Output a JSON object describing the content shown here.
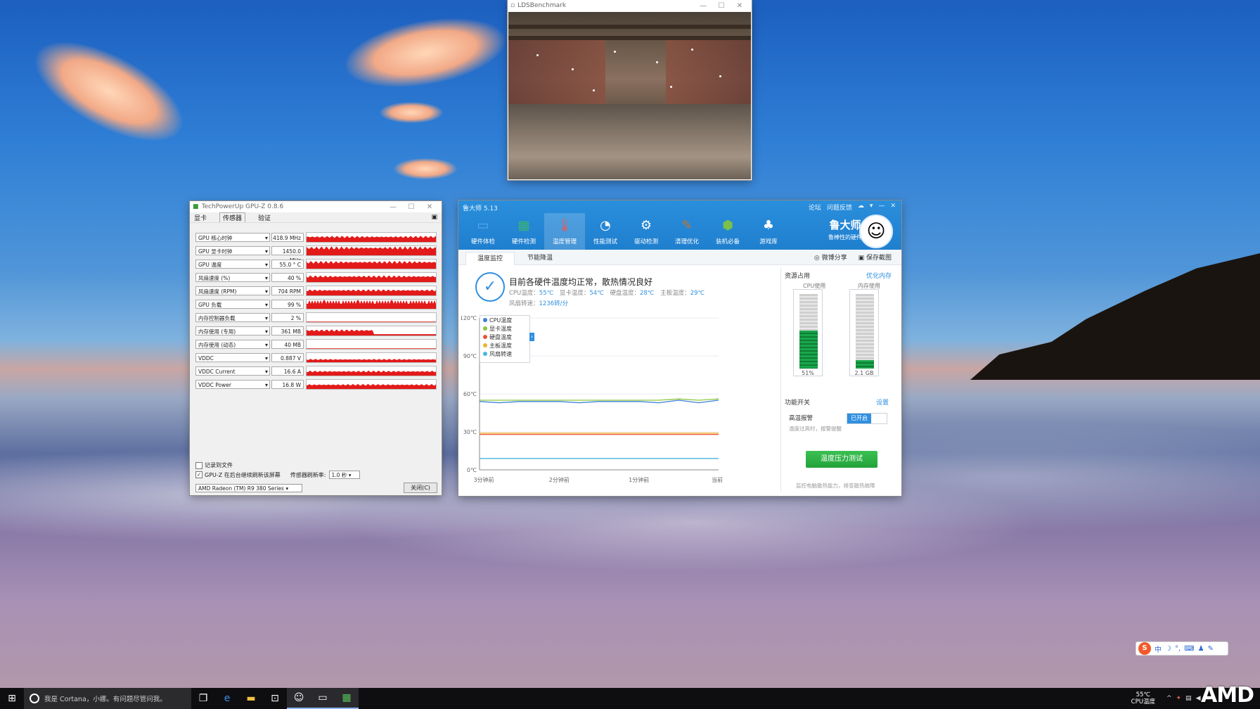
{
  "lds_window": {
    "title": "LDSBenchmark"
  },
  "gpuz": {
    "title": "TechPowerUp GPU-Z 0.8.6",
    "tabs": [
      "显卡",
      "传感器",
      "验证"
    ],
    "rows": [
      {
        "name": "GPU 核心时钟",
        "value": "418.9 MHz",
        "level": 0.55
      },
      {
        "name": "GPU 显卡时钟",
        "value": "1450.0 MHz",
        "level": 0.8
      },
      {
        "name": "GPU 温度",
        "value": "55.0 ° C",
        "level": 0.7
      },
      {
        "name": "风扇速度 (%)",
        "value": "40 %",
        "level": 0.6
      },
      {
        "name": "风扇速度 (RPM)",
        "value": "704 RPM",
        "level": 0.55
      },
      {
        "name": "GPU 负载",
        "value": "99 %",
        "level": 0.95
      },
      {
        "name": "内存控制器负载",
        "value": "2 %",
        "level": 0.05
      },
      {
        "name": "内存使用 (专用)",
        "value": "361 MB",
        "level": 0.55
      },
      {
        "name": "内存使用 (动态)",
        "value": "40 MB",
        "level": 0.05
      },
      {
        "name": "VDDC",
        "value": "0.887 V",
        "level": 0.3
      },
      {
        "name": "VDDC Current",
        "value": "16.6 A",
        "level": 0.45
      },
      {
        "name": "VDDC Power",
        "value": "16.8 W",
        "level": 0.45
      }
    ],
    "log_to_file": "记录到文件",
    "continue_refresh": "GPU-Z 在后台继续刷新该屏幕",
    "refresh_rate_label": "传感器刷新率:",
    "refresh_rate_value": "1.0 秒",
    "device": "AMD Radeon (TM) R9 380 Series",
    "close_button": "关闭(C)"
  },
  "ludashi": {
    "title": "鲁大师 5.13",
    "header_links": [
      "论坛",
      "问题反馈"
    ],
    "tools": [
      "硬件体检",
      "硬件检测",
      "温度管理",
      "性能测试",
      "驱动检测",
      "清理优化",
      "装机必备",
      "游戏库"
    ],
    "tool_icons": [
      "monitor-icon",
      "chip-icon",
      "thermometer-icon",
      "speedometer-icon",
      "gear-icon",
      "broom-icon",
      "box-icon",
      "gamepad-icon"
    ],
    "active_tool": 2,
    "brand": "鲁大师",
    "brand_slogan": "鲁棒性的硬件",
    "subtabs": [
      "温度监控",
      "节能降温"
    ],
    "share": "微博分享",
    "save_screenshot": "保存截图",
    "status_title": "目前各硬件温度均正常，散热情况良好",
    "temps": [
      {
        "label": "CPU温度：",
        "value": "55℃"
      },
      {
        "label": "显卡温度：",
        "value": "54℃"
      },
      {
        "label": "硬盘温度：",
        "value": "28℃"
      },
      {
        "label": "主板温度：",
        "value": "29℃"
      }
    ],
    "fan_label": "风扇转速：",
    "fan_value": "1236转/分",
    "resources_title": "资源占用",
    "optimize_memory": "优化内存",
    "cpu_usage_label": "CPU使用",
    "cpu_usage_value": "51%",
    "cpu_usage": 0.51,
    "mem_usage_label": "内存使用",
    "mem_usage_value": "2.1 GB",
    "mem_usage": 0.11,
    "feature_title": "功能开关",
    "settings": "设置",
    "high_temp_alarm": "高温报警",
    "alarm_state": "已开启",
    "alarm_desc": "温度过高时，报警提醒",
    "stress_test": "温度压力测试",
    "footer_note": "监控电脑散热能力，排查散热故障"
  },
  "chart_data": {
    "type": "line",
    "title": "",
    "xlabel": "",
    "ylabel": "",
    "y_ticks": [
      "120℃",
      "90℃",
      "60℃",
      "30℃",
      "0℃"
    ],
    "ylim": [
      0,
      120
    ],
    "x_ticks": [
      "3分钟前",
      "2分钟前",
      "1分钟前",
      "当前"
    ],
    "x": [
      0,
      1,
      2,
      3,
      4,
      5,
      6,
      7,
      8,
      9,
      10,
      11,
      12
    ],
    "series": [
      {
        "name": "CPU温度",
        "color": "#3a7fd6",
        "values": [
          54,
          53,
          54,
          54,
          54,
          53,
          54,
          54,
          54,
          53,
          55,
          53,
          55
        ]
      },
      {
        "name": "显卡温度",
        "color": "#8cc63e",
        "values": [
          55,
          55,
          55,
          55,
          55,
          55,
          55,
          55,
          55,
          55,
          56,
          55,
          56
        ]
      },
      {
        "name": "硬盘温度",
        "color": "#e8533a",
        "values": [
          28,
          28,
          28,
          28,
          28,
          28,
          28,
          28,
          28,
          28,
          28,
          28,
          28
        ]
      },
      {
        "name": "主板温度",
        "color": "#f2b233",
        "values": [
          29,
          29,
          29,
          29,
          29,
          29,
          29,
          29,
          29,
          29,
          29,
          29,
          29
        ]
      },
      {
        "name": "风扇转速",
        "color": "#49b6e0",
        "values": [
          9,
          9,
          9,
          9,
          9,
          9,
          9,
          9,
          9,
          9,
          9,
          9,
          9
        ]
      }
    ]
  },
  "taskbar": {
    "search_placeholder": "我是 Cortana，小娜。有问题尽管问我。",
    "tray_temp": "55℃",
    "tray_temp_label": "CPU温度"
  },
  "ime": {
    "label": "中"
  },
  "watermark": "AMD"
}
